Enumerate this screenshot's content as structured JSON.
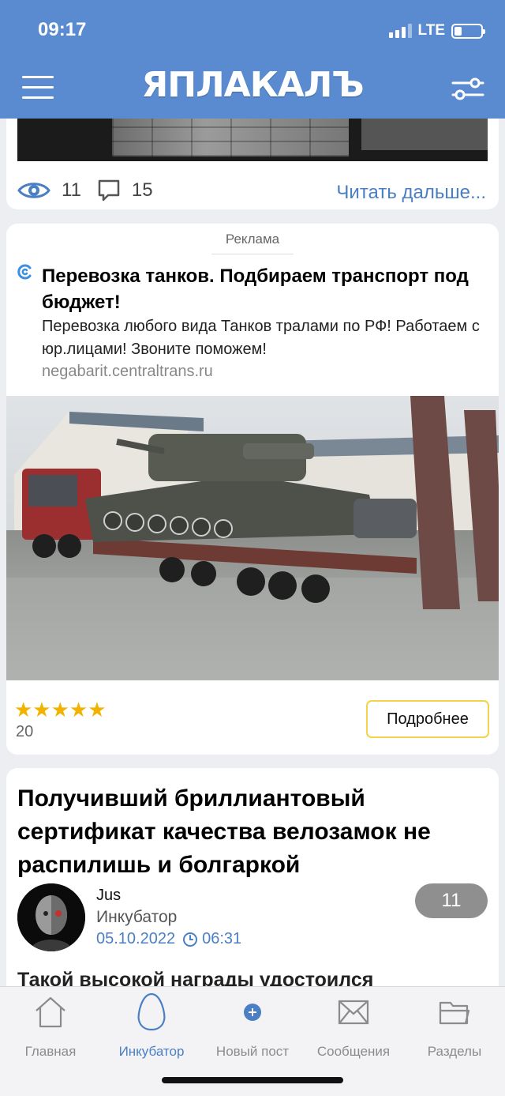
{
  "status": {
    "time": "09:17",
    "network": "LTE"
  },
  "header": {
    "logo": "ЯПЛАКАЛЪ",
    "menu_icon": "hamburger-icon",
    "settings_icon": "sliders-icon"
  },
  "top_post": {
    "views": "11",
    "comments": "15",
    "read_more": "Читать дальше..."
  },
  "ad": {
    "label": "Реклама",
    "title": "Перевозка танков. Подбираем транспорт под бюджет!",
    "text": "Перевозка любого вида Танков тралами по РФ! Работаем с юр.лицами! Звоните поможем!",
    "domain": "negabarit.centraltrans.ru",
    "rating_stars": "★★★★★",
    "rating": 5,
    "rating_count": "20",
    "button": "Подробнее"
  },
  "post": {
    "title": "Получивший бриллиантовый сертификат качества велозамок не распилишь и болгаркой",
    "author": "Jus",
    "section": "Инкубатор",
    "date": "05.10.2022",
    "time": "06:31",
    "comments": "11",
    "lead": "Такой высокой награды удостоился"
  },
  "nav": {
    "items": [
      {
        "label": "Главная",
        "icon": "home-icon"
      },
      {
        "label": "Инкубатор",
        "icon": "egg-icon"
      },
      {
        "label": "Новый пост",
        "icon": "plus-icon"
      },
      {
        "label": "Сообщения",
        "icon": "envelope-icon"
      },
      {
        "label": "Разделы",
        "icon": "folder-icon"
      }
    ],
    "active": "Инкубатор"
  },
  "colors": {
    "header": "#5a8bd0",
    "link": "#4a7fc4",
    "star": "#f2b300",
    "button_border": "#f3d24c"
  }
}
